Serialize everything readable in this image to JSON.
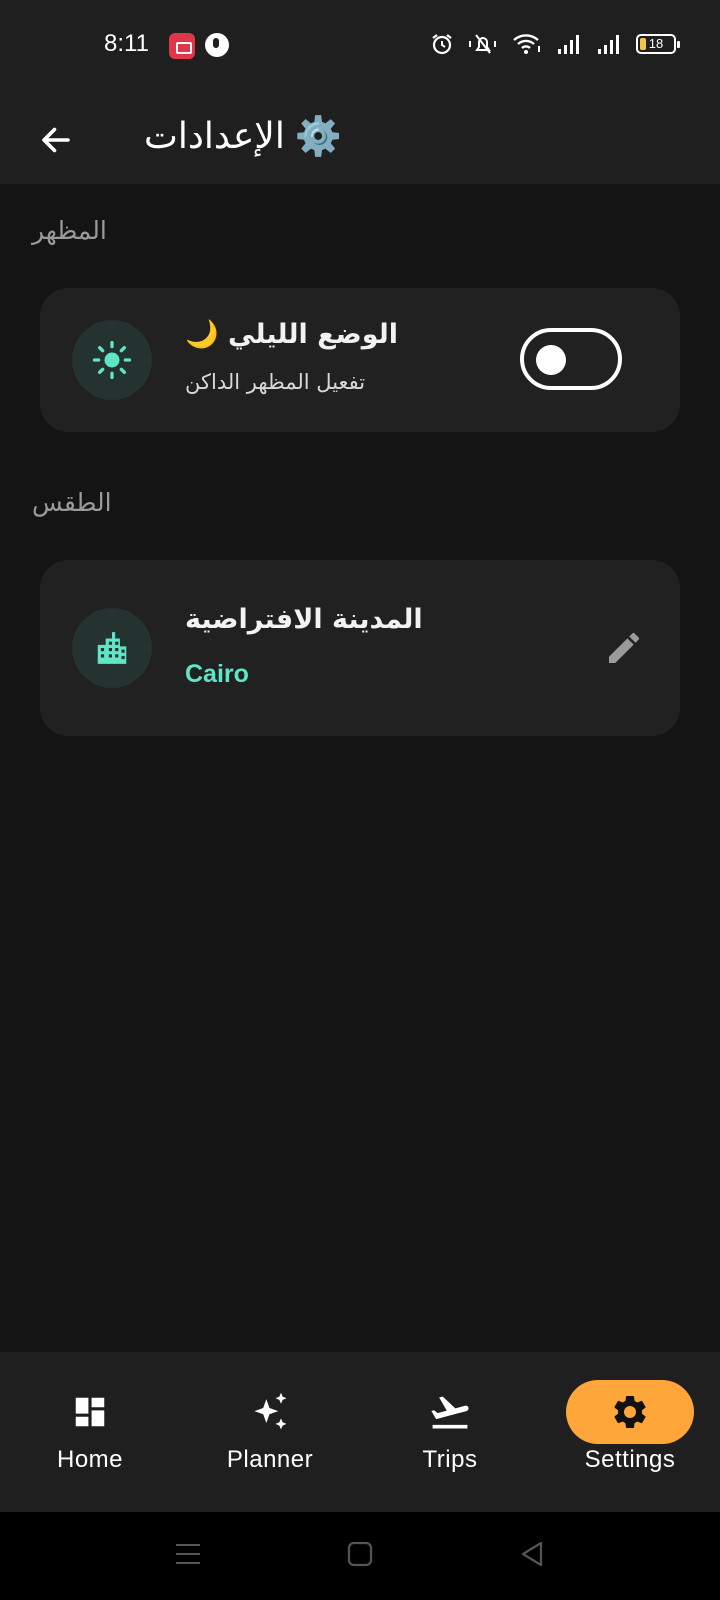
{
  "status_bar": {
    "time": "8:11",
    "battery": "18",
    "icons": [
      "screen-record-icon",
      "app-notification-icon",
      "alarm-icon",
      "mute-icon",
      "wifi-icon",
      "signal-icon",
      "signal-icon-2",
      "battery-icon"
    ]
  },
  "app_bar": {
    "title": "الإعدادات",
    "title_emoji": "⚙️",
    "back_icon": "arrow-back-icon"
  },
  "sections": {
    "appearance": {
      "label": "المظهر",
      "night_mode": {
        "title": "الوضع الليلي",
        "title_emoji": "🌙",
        "subtitle": "تفعيل المظهر الداكن",
        "icon": "sun-icon",
        "enabled": false
      }
    },
    "weather": {
      "label": "الطقس",
      "default_city": {
        "title": "المدينة الافتراضية",
        "value": "Cairo",
        "icon": "city-icon",
        "action_icon": "edit-icon"
      }
    }
  },
  "bottom_nav": {
    "items": [
      {
        "label": "Home",
        "icon": "dashboard-icon"
      },
      {
        "label": "Planner",
        "icon": "sparkle-icon"
      },
      {
        "label": "Trips",
        "icon": "flight-takeoff-icon"
      },
      {
        "label": "Settings",
        "icon": "gear-icon"
      }
    ],
    "active": "Settings"
  },
  "colors": {
    "background": "#141414",
    "surface": "#212121",
    "accent": "#ffa63b",
    "teal": "#5ee6c6"
  }
}
